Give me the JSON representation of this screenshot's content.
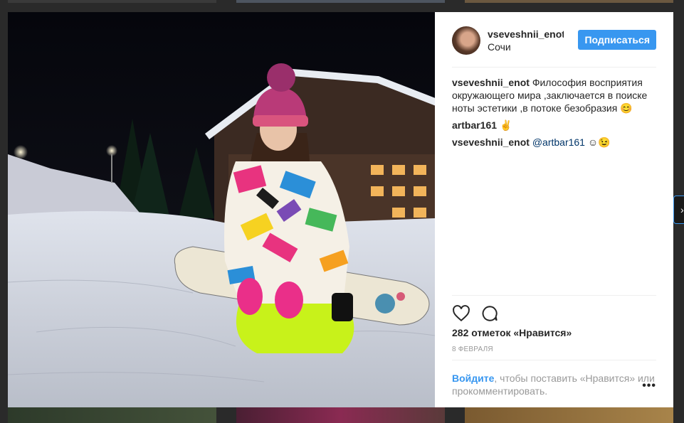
{
  "post": {
    "username": "vseveshnii_enot",
    "location": "Сочи",
    "follow_label": "Подписаться",
    "comments": [
      {
        "author": "vseveshnii_enot",
        "text": "Философия восприятия окружающего мира ,заключается в поиске ноты эстетики ,в потоке безобразия 😊"
      },
      {
        "author": "artbar161",
        "text": "✌"
      },
      {
        "author": "vseveshnii_enot",
        "mention": "@artbar161",
        "text": "☺😉"
      }
    ],
    "likes": "282 отметок «Нравится»",
    "date": "8 февраля",
    "login": {
      "link": "Войдите",
      "rest": ", чтобы поставить «Нравится» или прокомментировать."
    },
    "more": "•••"
  },
  "nav": {
    "next_arrow": "›"
  },
  "colors": {
    "accent": "#3897f0",
    "mention": "#003569"
  },
  "icons": [
    "heart-icon",
    "comment-icon",
    "more-options-icon",
    "chevron-right-icon"
  ]
}
